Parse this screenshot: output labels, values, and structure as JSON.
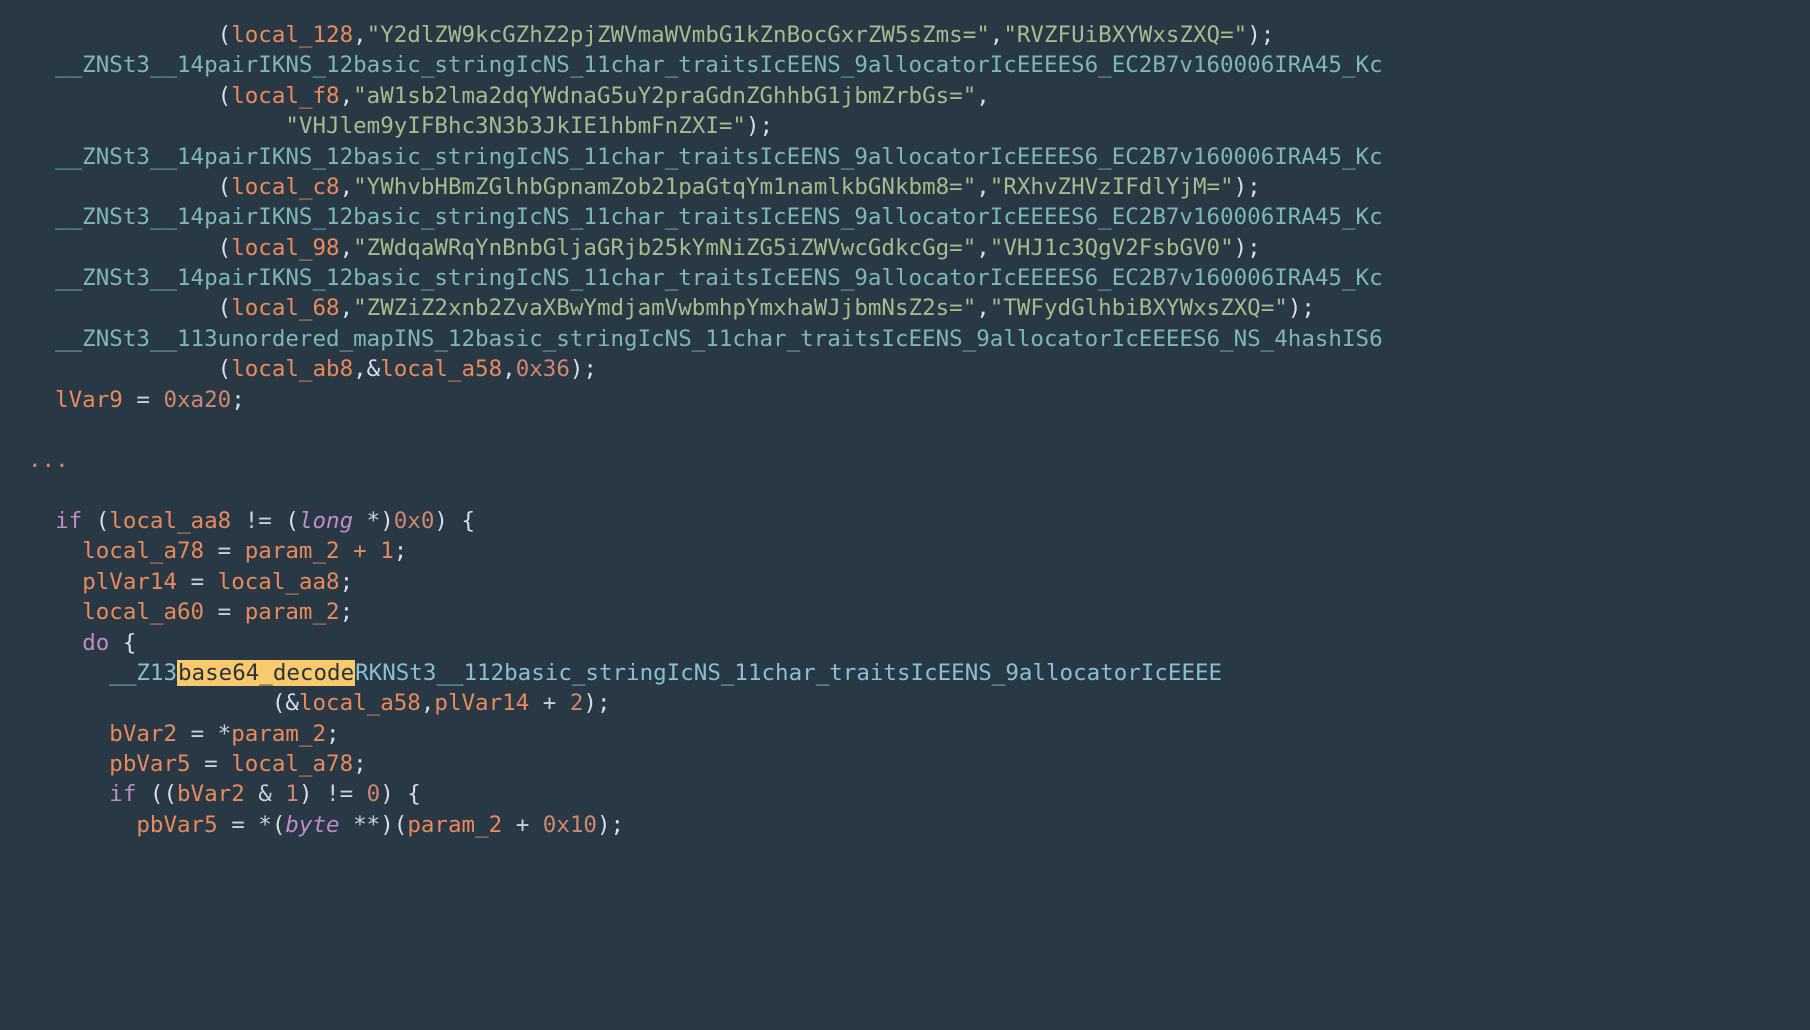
{
  "code": {
    "pair_fn": "__ZNSt3__14pairIKNS_12basic_stringIcNS_11char_traitsIcEENS_9allocatorIcEEEES6_EC2B7v160006IRA45_Kc",
    "umap_fn": "__ZNSt3__113unordered_mapINS_12basic_stringIcNS_11char_traitsIcEENS_9allocatorIcEEEES6_NS_4hashIS6",
    "b64_fn_prefix": "__Z13",
    "b64_fn_hl": "base64_decode",
    "b64_fn_suffix": "RKNSt3__112basic_stringIcNS_11char_traitsIcEENS_9allocatorIcEEEE",
    "calls": {
      "a": {
        "var": "local_128",
        "s1": "\"Y2dlZW9kcGZhZ2pjZWVmaWVmbG1kZnBocGxrZW5sZms=\"",
        "s2": "\"RVZFUiBXYWxsZXQ=\""
      },
      "b": {
        "var": "local_f8",
        "s1": "\"aW1sb2lma2dqYWdnaG5uY2praGdnZGhhbG1jbmZrbGs=\"",
        "s2_indent": "                   ",
        "s2": "\"VHJlem9yIFBhc3N3b3JkIE1hbmFnZXI=\""
      },
      "c": {
        "var": "local_c8",
        "s1": "\"YWhvbHBmZGlhbGpnamZob21paGtqYm1namlkbGNkbm8=\"",
        "s2": "\"RXhvZHVzIFdlYjM=\""
      },
      "d": {
        "var": "local_98",
        "s1": "\"ZWdqaWRqYnBnbGljaGRjb25kYmNiZG5iZWVwcGdkcGg=\"",
        "s2": "\"VHJ1c3QgV2FsbGV0\""
      },
      "e": {
        "var": "local_68",
        "s1": "\"ZWZiZ2xnb2ZvaXBwYmdjamVwbmhpYmxhaWJjbmNsZ2s=\"",
        "s2": "\"TWFydGlhbiBXYWxsZXQ=\""
      },
      "f": {
        "var": "local_ab8",
        "ref": "local_a58",
        "n": "0x36"
      }
    },
    "assign_1_l": "lVar9",
    "assign_1_r": "0xa20",
    "ell": "...",
    "if_cond_var": "local_aa8",
    "if_cond_type": "long",
    "if_cond_rhs": "0x0",
    "l_a78": "local_a78",
    "p2p1_rhs": "param_2 + 1",
    "plv14": "plVar14",
    "plv14_rhs": "local_aa8",
    "l_a60": "local_a60",
    "p2": "param_2",
    "kw_do": "do",
    "call_b64_arg0": "local_a58",
    "call_b64_arg1_l": "plVar14",
    "call_b64_arg1_r": "2",
    "bvar2": "bVar2",
    "pbvar5": "pbVar5",
    "pbvar5_rhs": "local_a78",
    "kw_if": "if",
    "mask": "1",
    "zero": "0",
    "byte_ty": "byte",
    "off": "0x10"
  }
}
